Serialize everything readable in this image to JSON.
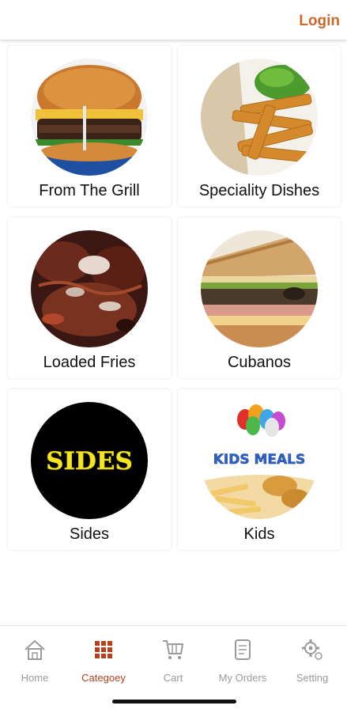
{
  "header": {
    "login_label": "Login"
  },
  "categories": [
    {
      "label": "From The Grill",
      "image": "burger"
    },
    {
      "label": "Speciality Dishes",
      "image": "fish-and-chips"
    },
    {
      "label": "Loaded Fries",
      "image": "loaded-fries"
    },
    {
      "label": "Cubanos",
      "image": "cuban-sandwich"
    },
    {
      "label": "Sides",
      "image": "sides-logo",
      "image_text": "SIDES"
    },
    {
      "label": "Kids",
      "image": "kids-meals-logo",
      "image_text": "KIDS MEALS"
    }
  ],
  "tabs": [
    {
      "label": "Home",
      "icon": "home-icon",
      "active": false
    },
    {
      "label": "Categoey",
      "icon": "grid-icon",
      "active": true
    },
    {
      "label": "Cart",
      "icon": "cart-icon",
      "active": false
    },
    {
      "label": "My Orders",
      "icon": "orders-scroll-icon",
      "active": false
    },
    {
      "label": "Setting",
      "icon": "gear-icon",
      "active": false
    }
  ],
  "colors": {
    "accent": "#c96a2c",
    "active_tab": "#b5421d",
    "inactive_tab": "#9a9a9a"
  }
}
